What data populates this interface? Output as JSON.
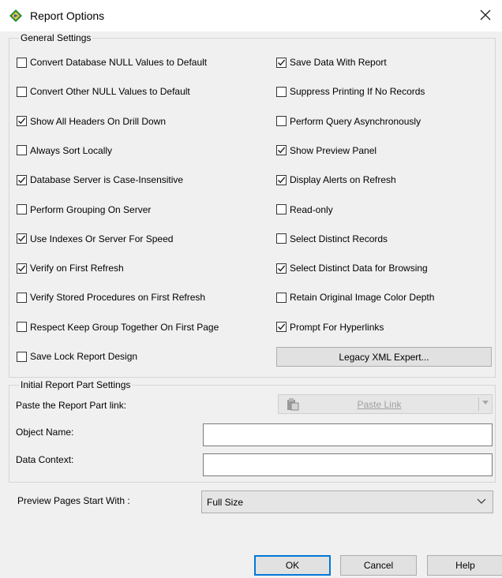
{
  "window": {
    "title": "Report Options",
    "close": "×"
  },
  "general": {
    "legend": "General Settings",
    "left": [
      {
        "label": "Convert Database NULL Values to Default",
        "checked": false
      },
      {
        "label": "Convert Other NULL Values to Default",
        "checked": false
      },
      {
        "label": "Show All Headers On Drill Down",
        "checked": true
      },
      {
        "label": "Always Sort Locally",
        "checked": false
      },
      {
        "label": "Database Server is Case-Insensitive",
        "checked": true
      },
      {
        "label": "Perform Grouping On Server",
        "checked": false
      },
      {
        "label": "Use Indexes Or Server For Speed",
        "checked": true
      },
      {
        "label": "Verify on First Refresh",
        "checked": true
      },
      {
        "label": "Verify Stored Procedures on First Refresh",
        "checked": false
      },
      {
        "label": "Respect Keep Group Together On First Page",
        "checked": false
      },
      {
        "label": "Save Lock Report Design",
        "checked": false
      }
    ],
    "right": [
      {
        "label": "Save Data With Report",
        "checked": true
      },
      {
        "label": "Suppress Printing If No Records",
        "checked": false
      },
      {
        "label": "Perform Query Asynchronously",
        "checked": false
      },
      {
        "label": "Show Preview Panel",
        "checked": true
      },
      {
        "label": "Display Alerts on Refresh",
        "checked": true
      },
      {
        "label": "Read-only",
        "checked": false
      },
      {
        "label": "Select Distinct Records",
        "checked": false
      },
      {
        "label": "Select Distinct Data for Browsing",
        "checked": true
      },
      {
        "label": "Retain Original Image Color Depth",
        "checked": false
      },
      {
        "label": "Prompt For Hyperlinks",
        "checked": true
      }
    ],
    "legacy_button": "Legacy XML Expert..."
  },
  "report_part": {
    "legend": "Initial Report Part Settings",
    "paste_label": "Paste the Report Part link:",
    "paste_button": "Paste Link",
    "object_name_label": "Object Name:",
    "object_name_value": "",
    "data_context_label": "Data Context:",
    "data_context_value": ""
  },
  "preview": {
    "label": "Preview Pages Start With :",
    "value": "Full Size"
  },
  "buttons": {
    "ok": "OK",
    "cancel": "Cancel",
    "help": "Help"
  }
}
